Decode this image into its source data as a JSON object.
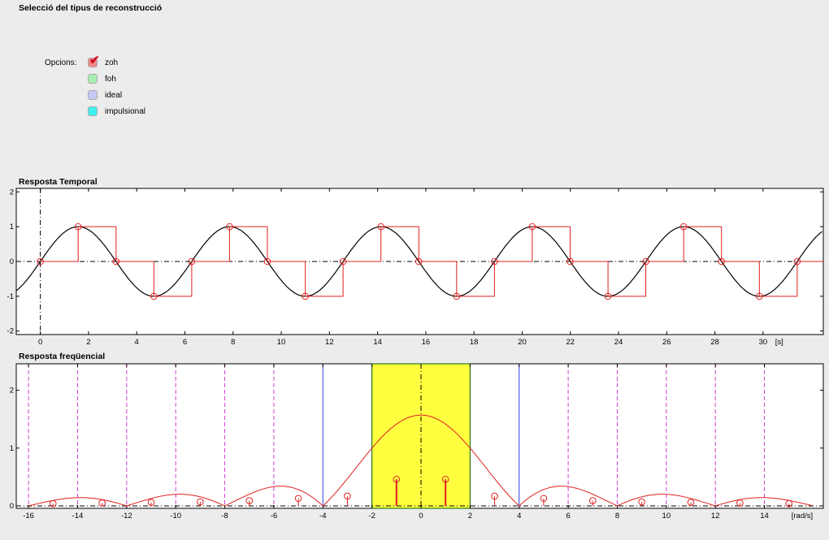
{
  "selection": {
    "title": "Selecció del tipus de reconstrucció",
    "options_label": "Opcions:",
    "options": [
      {
        "label": "zoh",
        "checked": true,
        "color": "#f08a8a"
      },
      {
        "label": "foh",
        "checked": false,
        "color": "#a8f0b0"
      },
      {
        "label": "ideal",
        "checked": false,
        "color": "#c8c8f4"
      },
      {
        "label": "impulsional",
        "checked": false,
        "color": "#40f0f0"
      }
    ]
  },
  "chart_data": [
    {
      "type": "line",
      "title": "Resposta Temporal",
      "xlabel": "[s]",
      "xlim": [
        -1,
        32.5
      ],
      "ylim": [
        -2.1,
        2.1
      ],
      "xticks": [
        0,
        2,
        4,
        6,
        8,
        10,
        12,
        14,
        16,
        18,
        20,
        22,
        24,
        26,
        28,
        30
      ],
      "yticks": [
        -2,
        -1,
        0,
        1,
        2
      ],
      "series": [
        {
          "kind": "continuous",
          "function": "sin(t)",
          "color": "#000000"
        },
        {
          "kind": "samples",
          "color": "#e02020",
          "t": [
            0,
            1.5708,
            3.1416,
            4.7124,
            6.2832,
            7.854,
            9.4248,
            10.9956,
            12.5664,
            14.1372,
            15.708,
            17.2788,
            18.8496,
            20.4204,
            21.9911,
            23.5619,
            25.1327,
            26.7035,
            28.2743,
            29.8451,
            31.4159
          ],
          "y": [
            0,
            1,
            0,
            -1,
            0,
            1,
            0,
            -1,
            0,
            1,
            0,
            -1,
            0,
            1,
            0,
            -1,
            0,
            1,
            0,
            -1,
            0
          ]
        },
        {
          "kind": "zoh",
          "color": "#e02020",
          "period": 1.5708
        }
      ]
    },
    {
      "type": "line",
      "title": "Resposta freqüencial",
      "xlabel": "[rad/s]",
      "xlim": [
        -16.5,
        16.4
      ],
      "ylim": [
        0,
        2.5
      ],
      "xticks": [
        -16,
        -14,
        -12,
        -10,
        -8,
        -6,
        -4,
        -2,
        0,
        2,
        4,
        6,
        8,
        10,
        12,
        14
      ],
      "yticks": [
        0,
        1,
        2
      ],
      "passband": {
        "from": -2,
        "to": 2,
        "color": "#ffff40"
      },
      "blue_lines": [
        -4,
        4
      ],
      "magenta_lines": [
        -16,
        -14,
        -12,
        -10,
        -8,
        -6,
        6,
        8,
        10,
        12,
        14
      ],
      "curve": {
        "function": "1.5708*|sinc(w/4)|",
        "color": "#e02020"
      },
      "stems": {
        "x": [
          -15,
          -13,
          -11,
          -9,
          -7,
          -5,
          -3,
          -1,
          1,
          3,
          5,
          7,
          9,
          11,
          13,
          15
        ],
        "y": [
          0.04,
          0.05,
          0.06,
          0.07,
          0.09,
          0.13,
          0.17,
          0.46,
          0.46,
          0.17,
          0.13,
          0.09,
          0.07,
          0.06,
          0.05,
          0.04
        ],
        "color": "#e02020"
      }
    }
  ]
}
